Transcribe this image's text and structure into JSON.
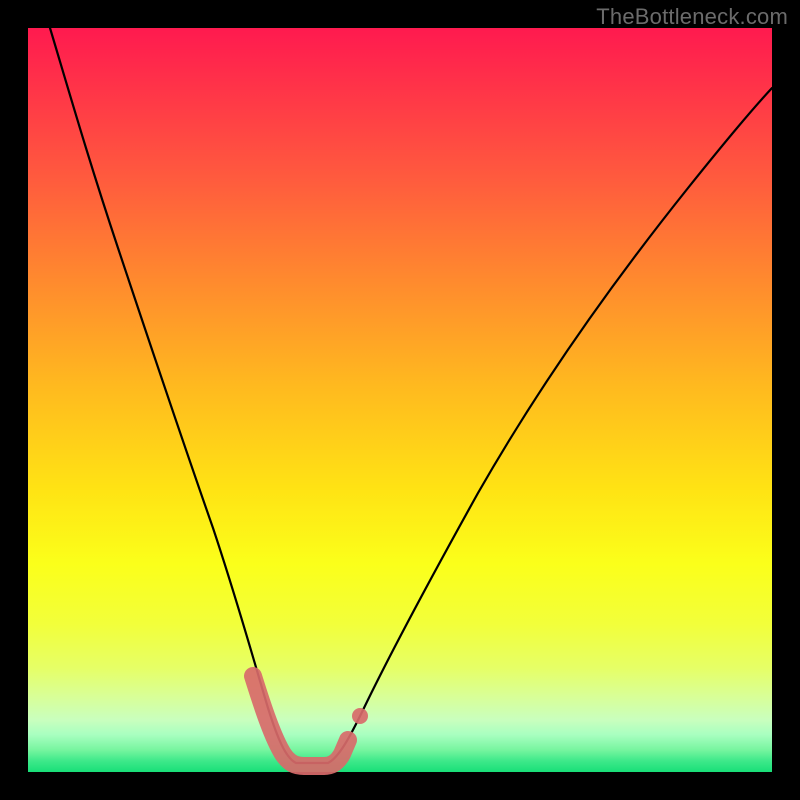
{
  "watermark": "TheBottleneck.com",
  "colors": {
    "frame": "#000000",
    "curve": "#000000",
    "valley_highlight": "#d86a6a",
    "gradient_top": "#ff1a4f",
    "gradient_bottom": "#18df78"
  },
  "chart_data": {
    "type": "line",
    "title": "",
    "xlabel": "",
    "ylabel": "",
    "xlim": [
      0,
      100
    ],
    "ylim": [
      0,
      100
    ],
    "grid": false,
    "legend": false,
    "series": [
      {
        "name": "bottleneck-curve",
        "x": [
          3,
          6,
          10,
          14,
          18,
          22,
          26,
          29,
          31,
          33,
          35,
          37,
          39,
          41,
          44,
          48,
          54,
          60,
          68,
          76,
          86,
          96,
          100
        ],
        "y": [
          100,
          90,
          78,
          66,
          54,
          42,
          28,
          16,
          9,
          4,
          2,
          1.5,
          2,
          3,
          7,
          14,
          24,
          34,
          45,
          55,
          66,
          76,
          80
        ]
      }
    ],
    "annotations": [
      {
        "name": "valley-highlight",
        "x": [
          29,
          31,
          33,
          35,
          37,
          39,
          41
        ],
        "y": [
          16,
          9,
          4,
          2,
          1.5,
          2,
          3
        ]
      },
      {
        "name": "valley-marker-dot",
        "x": 42.5,
        "y": 4.5
      }
    ]
  }
}
